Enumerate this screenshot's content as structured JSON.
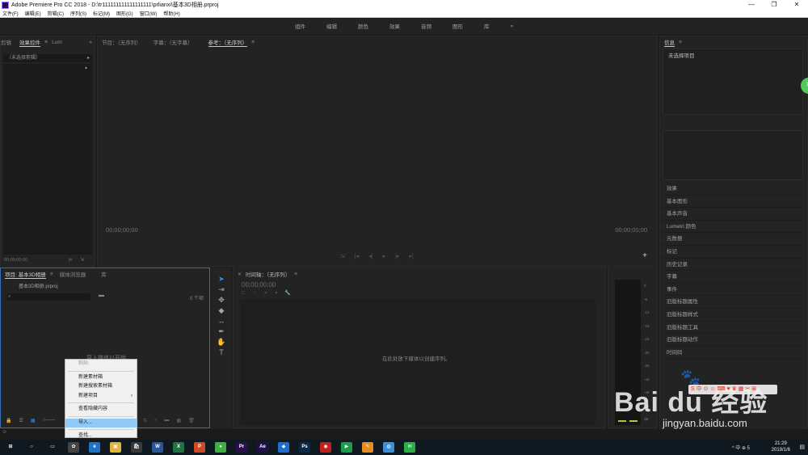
{
  "window": {
    "title": "Adobe Premiere Pro CC 2018 - D:\\tr111111111111111111\\prlianxi\\基本3D相册.prproj",
    "minimize": "—",
    "restore": "❐",
    "close": "✕"
  },
  "menu": [
    "文件(F)",
    "编辑(E)",
    "剪辑(C)",
    "序列(S)",
    "标记(M)",
    "图形(G)",
    "窗口(W)",
    "帮助(H)"
  ],
  "workspaces": [
    "组件",
    "编辑",
    "颜色",
    "效果",
    "音频",
    "图形",
    "库",
    "»"
  ],
  "left_panel": {
    "tabs": [
      "剪辑",
      "效果控件",
      "Lum"
    ],
    "more": "»",
    "clip_label": "（未选择剪辑）",
    "timecode": "00;00;00;00"
  },
  "source_panel": {
    "tabs": [
      "节目：（无序列）",
      "字幕：（无字幕）",
      "参考：（无序列）"
    ],
    "timecode_left": "00;00;00;00",
    "timecode_right": "00;00;00;00",
    "add": "+"
  },
  "right_panel": {
    "info_title": "信息",
    "info_value": "未选择项目",
    "items": [
      "效果",
      "基本图形",
      "基本声音",
      "Lumetri 颜色",
      "元数据",
      "标记",
      "历史记录",
      "字幕",
      "事件",
      "旧版标题属性",
      "旧版标题样式",
      "旧版标题工具",
      "旧版标题动作",
      "时间码"
    ],
    "badge": "70"
  },
  "project_panel": {
    "tabs": [
      "项目: 基本3D相册",
      "媒体浏览器",
      "库"
    ],
    "file": "基本3D相册.prproj",
    "count": "0 个项",
    "hint": "导入媒体以开始"
  },
  "timeline": {
    "title": "时间轴：（无序列）",
    "timecode": "00;00;00;00",
    "hint": "在此处放下媒体以创建序列。"
  },
  "audio_meter": {
    "ticks": [
      "0",
      "-6",
      "-12",
      "-18",
      "-24",
      "-30",
      "-36",
      "-42",
      "-48",
      "-54",
      "dB"
    ]
  },
  "context_menu": [
    {
      "label": "粘贴",
      "disabled": true
    },
    {
      "sep": true
    },
    {
      "label": "新建素材箱"
    },
    {
      "label": "新建搜索素材箱"
    },
    {
      "label": "新建项目",
      "arrow": "›"
    },
    {
      "sep": true
    },
    {
      "label": "查看隐藏内容"
    },
    {
      "sep": true
    },
    {
      "label": "导入...",
      "selected": true
    },
    {
      "sep": true
    },
    {
      "label": "查找..."
    }
  ],
  "taskbar": {
    "apps": [
      {
        "name": "start",
        "label": "⊞",
        "color": "#101820"
      },
      {
        "name": "search",
        "label": "○",
        "color": "#101820"
      },
      {
        "name": "task-view",
        "label": "▭",
        "color": "#101820"
      },
      {
        "name": "app-flower",
        "label": "✿",
        "color": "#444444"
      },
      {
        "name": "edge",
        "label": "e",
        "color": "#1e73c8"
      },
      {
        "name": "files",
        "label": "▣",
        "color": "#e2b53a"
      },
      {
        "name": "store",
        "label": "🛍",
        "color": "#3a3a3a"
      },
      {
        "name": "word",
        "label": "W",
        "color": "#2b579a"
      },
      {
        "name": "excel",
        "label": "X",
        "color": "#217346"
      },
      {
        "name": "powerpoint",
        "label": "P",
        "color": "#d24726"
      },
      {
        "name": "app-green",
        "label": "●",
        "color": "#3cb043"
      },
      {
        "name": "premiere",
        "label": "Pr",
        "color": "#2b0e4c"
      },
      {
        "name": "after-effects",
        "label": "Ae",
        "color": "#1f0f4a"
      },
      {
        "name": "app-bird",
        "label": "◆",
        "color": "#1c6fd1"
      },
      {
        "name": "photoshop",
        "label": "Ps",
        "color": "#0a2a48"
      },
      {
        "name": "app-red",
        "label": "◉",
        "color": "#c0201e"
      },
      {
        "name": "app-play",
        "label": "▶",
        "color": "#1c9c4a"
      },
      {
        "name": "app-orange",
        "label": "✎",
        "color": "#e58b1f"
      },
      {
        "name": "app-ball",
        "label": "◍",
        "color": "#3a8fd8"
      },
      {
        "name": "wechat",
        "label": "✉",
        "color": "#2aae47"
      }
    ],
    "tray": "^ 中 ⊕ 5",
    "time": "21:29",
    "date": "2019/1/6"
  },
  "watermark": {
    "brand": "Bai du 经验",
    "url": "jingyan.baidu.com"
  }
}
